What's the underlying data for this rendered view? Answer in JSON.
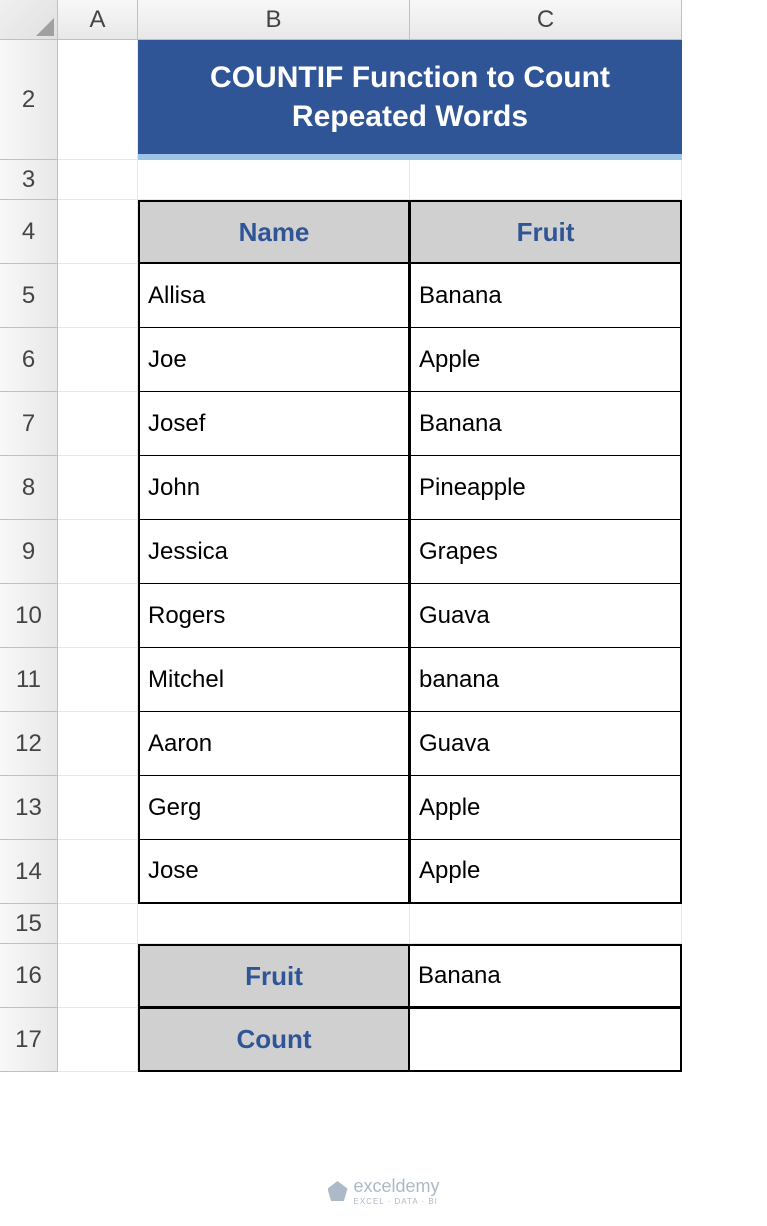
{
  "columns": [
    "A",
    "B",
    "C"
  ],
  "rows": [
    "2",
    "3",
    "4",
    "5",
    "6",
    "7",
    "8",
    "9",
    "10",
    "11",
    "12",
    "13",
    "14",
    "15",
    "16",
    "17"
  ],
  "title": "COUNTIF Function to Count Repeated Words",
  "table": {
    "headers": {
      "name": "Name",
      "fruit": "Fruit"
    },
    "rows": [
      {
        "name": "Allisa",
        "fruit": "Banana"
      },
      {
        "name": "Joe",
        "fruit": "Apple"
      },
      {
        "name": "Josef",
        "fruit": "Banana"
      },
      {
        "name": "John",
        "fruit": "Pineapple"
      },
      {
        "name": "Jessica",
        "fruit": "Grapes"
      },
      {
        "name": "Rogers",
        "fruit": "Guava"
      },
      {
        "name": "Mitchel",
        "fruit": "banana"
      },
      {
        "name": "Aaron",
        "fruit": "Guava"
      },
      {
        "name": "Gerg",
        "fruit": "Apple"
      },
      {
        "name": "Jose",
        "fruit": "Apple"
      }
    ]
  },
  "summary": {
    "fruit_label": "Fruit",
    "fruit_value": "Banana",
    "count_label": "Count",
    "count_value": ""
  },
  "watermark": {
    "name": "exceldemy",
    "tagline": "EXCEL · DATA · BI"
  }
}
